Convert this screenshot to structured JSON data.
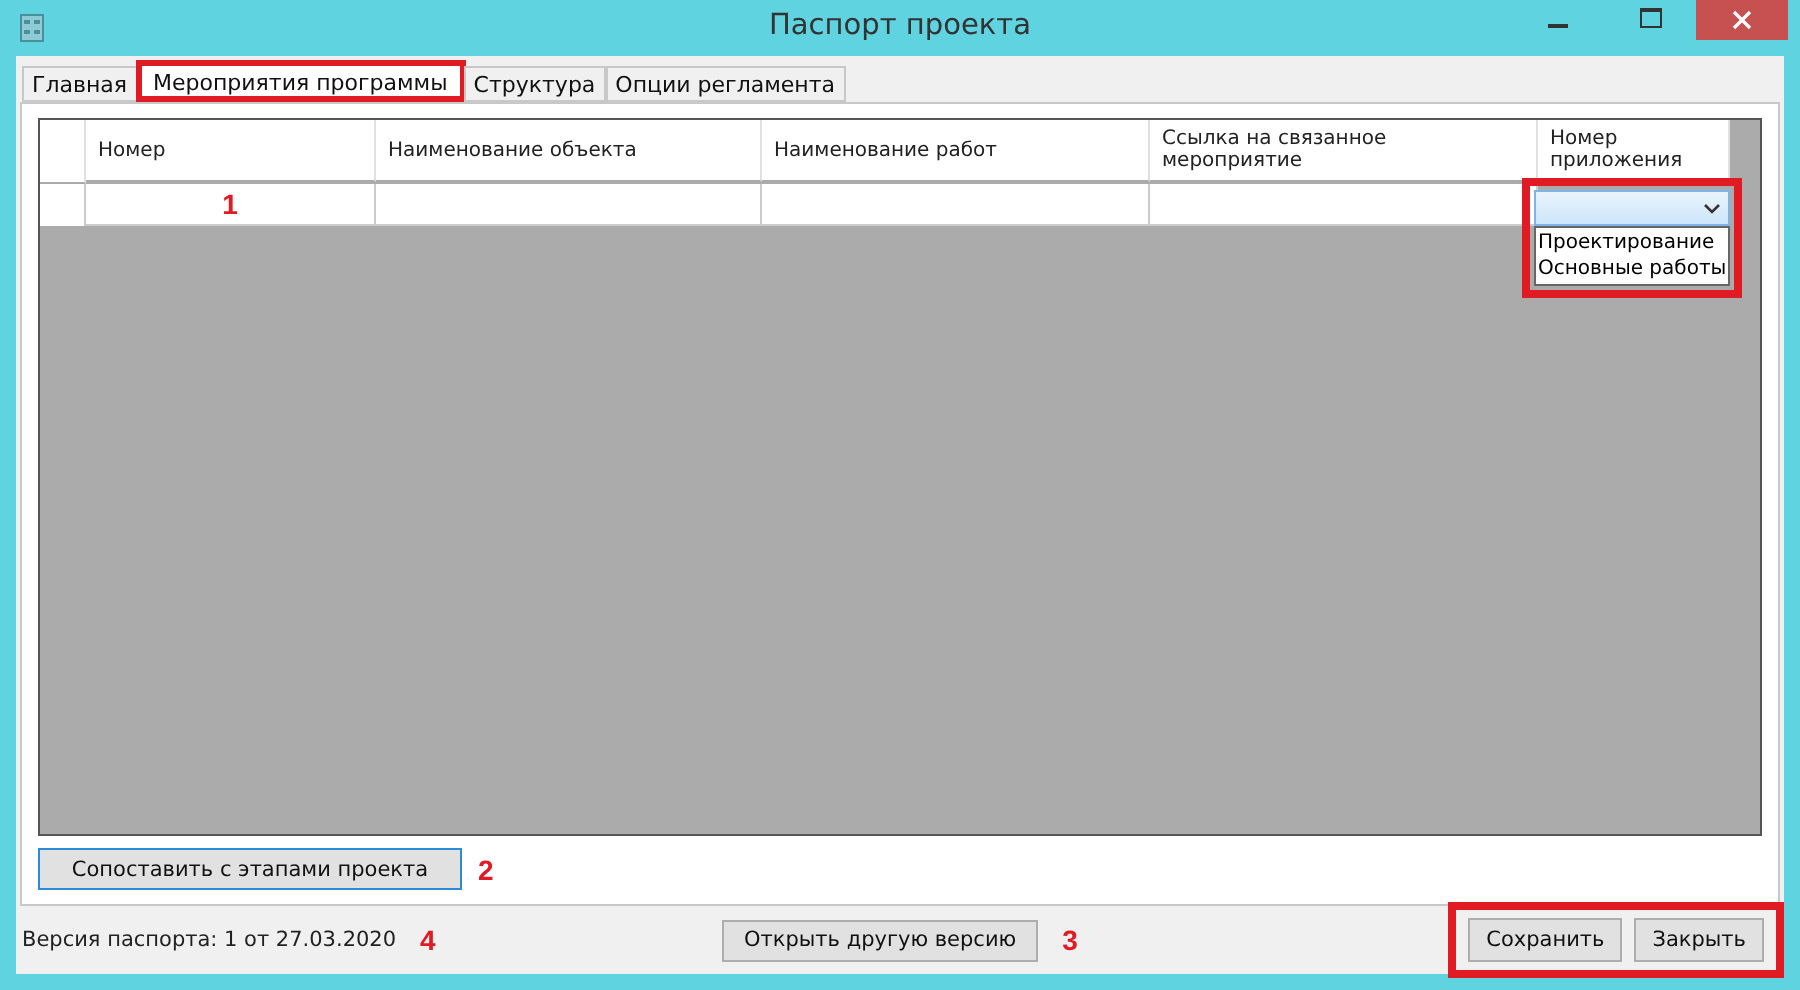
{
  "window": {
    "title": "Паспорт проекта"
  },
  "tabs": [
    {
      "label": "Главная",
      "selected": false,
      "highlighted": false
    },
    {
      "label": "Мероприятия программы",
      "selected": true,
      "highlighted": true
    },
    {
      "label": "Структура",
      "selected": false,
      "highlighted": false
    },
    {
      "label": "Опции регламента",
      "selected": false,
      "highlighted": false
    }
  ],
  "table": {
    "columns": [
      "Номер",
      "Наименование объекта",
      "Наименование работ",
      "Ссылка на связанное мероприятие",
      "Номер приложения"
    ],
    "row_marker": "1",
    "dropdown": {
      "highlighted": true,
      "options": [
        "Проектирование",
        "Основные работы"
      ]
    }
  },
  "match_button": {
    "label": "Сопоставить с этапами проекта",
    "marker": "2"
  },
  "status_bar": {
    "version": "Версия паспорта: 1 от 27.03.2020",
    "marker": "4"
  },
  "open_button": {
    "label": "Открыть другую версию",
    "marker": "3"
  },
  "buttons": {
    "highlighted": true,
    "items": [
      "Сохранить",
      "Закрыть"
    ]
  }
}
